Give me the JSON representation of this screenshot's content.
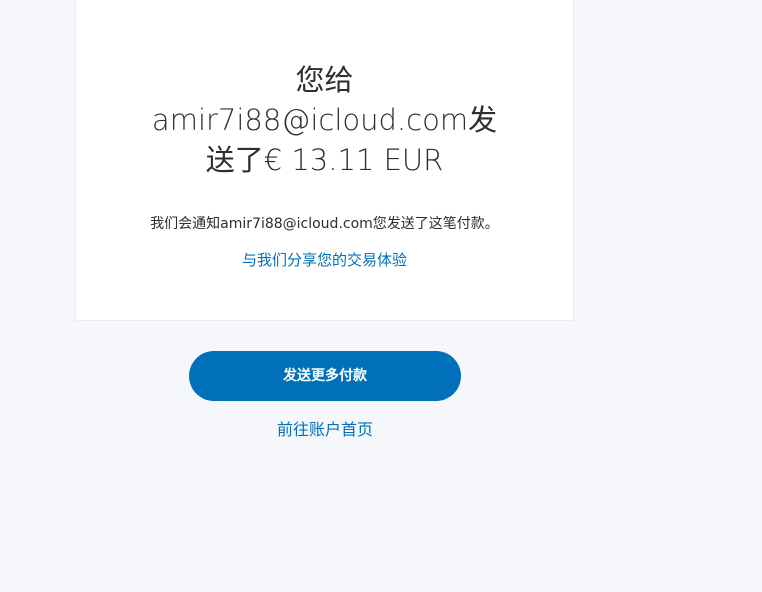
{
  "card": {
    "headline_line1": "您给",
    "headline_line2": "amir7i88@icloud.com发",
    "headline_line3": "送了€ 13.11 EUR",
    "notice": "我们会通知amir7i88@icloud.com您发送了这笔付款。",
    "share_link": "与我们分享您的交易体验"
  },
  "actions": {
    "send_more_label": "发送更多付款",
    "account_home_label": "前往账户首页"
  },
  "colors": {
    "background": "#f5f7fa",
    "card": "#ffffff",
    "accent": "#0070ba",
    "text": "#2c2e2f"
  }
}
